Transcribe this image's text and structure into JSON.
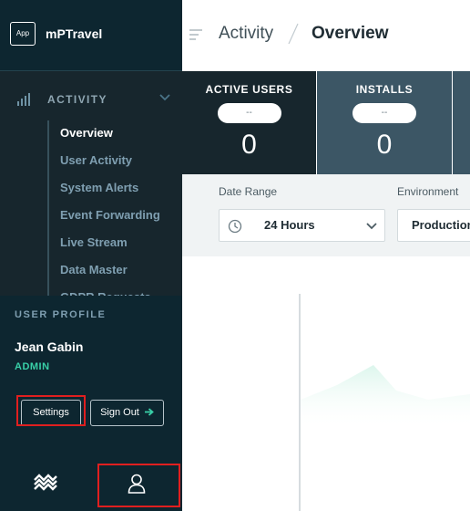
{
  "brand": {
    "badge": "App",
    "name": "mPTravel"
  },
  "nav": {
    "section_label": "ACTIVITY",
    "items": [
      {
        "label": "Overview",
        "active": true
      },
      {
        "label": "User Activity"
      },
      {
        "label": "System Alerts"
      },
      {
        "label": "Event Forwarding"
      },
      {
        "label": "Live Stream"
      },
      {
        "label": "Data Master"
      },
      {
        "label": "GDPR Requests"
      }
    ]
  },
  "profile": {
    "section_label": "USER PROFILE",
    "name": "Jean Gabin",
    "role": "ADMIN",
    "settings_label": "Settings",
    "signout_label": "Sign Out"
  },
  "header": {
    "crumb_parent": "Activity",
    "crumb_current": "Overview"
  },
  "metrics": [
    {
      "title": "ACTIVE USERS",
      "pill": "--",
      "value": "0"
    },
    {
      "title": "INSTALLS",
      "pill": "--",
      "value": "0"
    }
  ],
  "filters": {
    "date_range_label": "Date Range",
    "date_range_value": "24 Hours",
    "environment_label": "Environment",
    "environment_value": "Production"
  },
  "colors": {
    "accent": "#39d0a8",
    "sidebar": "#17262d",
    "highlight": "#e01f1f"
  },
  "icons": {
    "nav": "bar-chart-icon",
    "footer_left": "wave-logo-icon",
    "footer_right": "user-icon"
  }
}
